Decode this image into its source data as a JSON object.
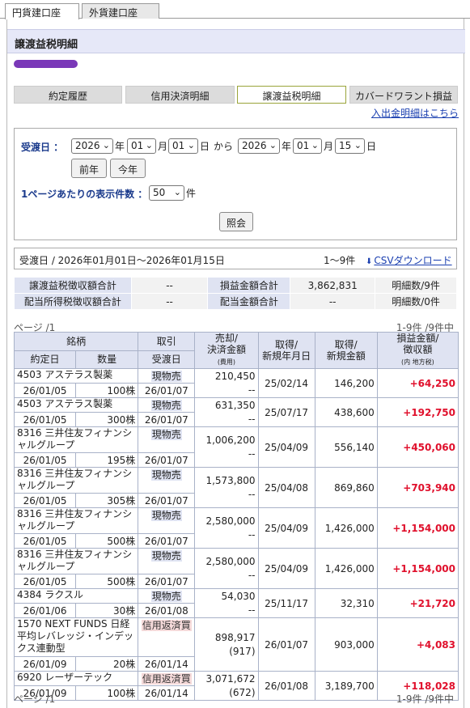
{
  "top_tabs": [
    {
      "label": "円貨建口座",
      "active": true
    },
    {
      "label": "外貨建口座",
      "active": false
    }
  ],
  "page_title": "譲渡益税明細",
  "sub_tabs": [
    "約定履歴",
    "信用決済明細",
    "譲渡益税明細",
    "カバードワラント損益"
  ],
  "deposit_link": "入出金明細はこちら",
  "search": {
    "date_label": "受渡日 ：",
    "from": {
      "year": "2026",
      "month": "01",
      "day": "01"
    },
    "to": {
      "year": "2026",
      "month": "01",
      "day": "15"
    },
    "unit_year": "年",
    "unit_month": "月",
    "unit_day": "日",
    "kara": "から",
    "prev_year_btn": "前年",
    "this_year_btn": "今年",
    "per_page_label": "1ページあたりの表示件数 ：",
    "per_page_value": "50",
    "per_page_unit": "件",
    "submit_btn": "照会"
  },
  "range": {
    "text": "受渡日 / 2026年01月01日～2026年01月15日",
    "count": "1〜9件",
    "csv_label": "CSVダウンロード"
  },
  "summary": {
    "rows": [
      [
        "譲渡益税徴収額合計",
        "--",
        "損益金額合計",
        "3,862,831",
        "明細数/9件"
      ],
      [
        "配当所得税徴収額合計",
        "--",
        "配当金額合計",
        "--",
        "明細数/0件"
      ]
    ]
  },
  "pager": {
    "left": "ページ /1",
    "right": "1-9件 /9件中"
  },
  "table_headers": {
    "security": "銘柄",
    "trade": "取引",
    "sale": "売却/\n決済金額",
    "sale_sub": "(費用)",
    "acq_date": "取得/\n新規年月日",
    "acq_amount": "取得/\n新規金額",
    "pl": "損益金額/\n徴収額",
    "pl_sub": "(内 地方税)",
    "contract_date": "約定日",
    "quantity": "数量",
    "settle_date": "受渡日"
  },
  "rows": [
    {
      "name": "4503 アステラス製薬",
      "trade": "現物売",
      "trade_type": "buy",
      "sale": "210,450",
      "cost": "--",
      "acq_date": "25/02/14",
      "acq_amount": "146,200",
      "pl": "+64,250",
      "contract": "26/01/05",
      "qty": "100株",
      "settle": "26/01/07"
    },
    {
      "name": "4503 アステラス製薬",
      "trade": "現物売",
      "trade_type": "buy",
      "sale": "631,350",
      "cost": "--",
      "acq_date": "25/07/17",
      "acq_amount": "438,600",
      "pl": "+192,750",
      "contract": "26/01/05",
      "qty": "300株",
      "settle": "26/01/07"
    },
    {
      "name": "8316 三井住友フィナンシャルグループ",
      "trade": "現物売",
      "trade_type": "buy",
      "sale": "1,006,200",
      "cost": "--",
      "acq_date": "25/04/09",
      "acq_amount": "556,140",
      "pl": "+450,060",
      "contract": "26/01/05",
      "qty": "195株",
      "settle": "26/01/07"
    },
    {
      "name": "8316 三井住友フィナンシャルグループ",
      "trade": "現物売",
      "trade_type": "buy",
      "sale": "1,573,800",
      "cost": "--",
      "acq_date": "25/04/08",
      "acq_amount": "869,860",
      "pl": "+703,940",
      "contract": "26/01/05",
      "qty": "305株",
      "settle": "26/01/07"
    },
    {
      "name": "8316 三井住友フィナンシャルグループ",
      "trade": "現物売",
      "trade_type": "buy",
      "sale": "2,580,000",
      "cost": "--",
      "acq_date": "25/04/09",
      "acq_amount": "1,426,000",
      "pl": "+1,154,000",
      "contract": "26/01/05",
      "qty": "500株",
      "settle": "26/01/07"
    },
    {
      "name": "8316 三井住友フィナンシャルグループ",
      "trade": "現物売",
      "trade_type": "buy",
      "sale": "2,580,000",
      "cost": "--",
      "acq_date": "25/04/09",
      "acq_amount": "1,426,000",
      "pl": "+1,154,000",
      "contract": "26/01/05",
      "qty": "500株",
      "settle": "26/01/07"
    },
    {
      "name": "4384 ラクスル",
      "trade": "現物売",
      "trade_type": "buy",
      "sale": "54,030",
      "cost": "--",
      "acq_date": "25/11/17",
      "acq_amount": "32,310",
      "pl": "+21,720",
      "contract": "26/01/06",
      "qty": "30株",
      "settle": "26/01/08"
    },
    {
      "name": "1570 NEXT FUNDS 日経平均レバレッジ・インデックス連動型",
      "trade": "信用返済買",
      "trade_type": "credit",
      "sale": "898,917",
      "cost": "(917)",
      "acq_date": "26/01/07",
      "acq_amount": "903,000",
      "pl": "+4,083",
      "contract": "26/01/09",
      "qty": "20株",
      "settle": "26/01/14"
    },
    {
      "name": "6920 レーザーテック",
      "trade": "信用返済買",
      "trade_type": "credit",
      "sale": "3,071,672",
      "cost": "(672)",
      "acq_date": "26/01/08",
      "acq_amount": "3,189,700",
      "pl": "+118,028",
      "contract": "26/01/09",
      "qty": "100株",
      "settle": "26/01/14"
    }
  ]
}
